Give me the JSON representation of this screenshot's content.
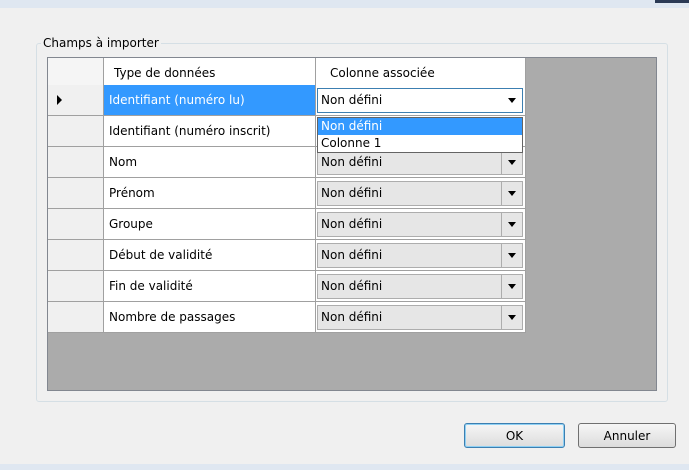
{
  "group_label": "Champs à importer",
  "columns": {
    "type": "Type de données",
    "column": "Colonne associée"
  },
  "rows": [
    {
      "type": "Identifiant (numéro lu)",
      "column": "Non défini"
    },
    {
      "type": "Identifiant (numéro inscrit)",
      "column": ""
    },
    {
      "type": "Nom",
      "column": "Non défini"
    },
    {
      "type": "Prénom",
      "column": "Non défini"
    },
    {
      "type": "Groupe",
      "column": "Non défini"
    },
    {
      "type": "Début de validité",
      "column": "Non défini"
    },
    {
      "type": "Fin de validité",
      "column": "Non défini"
    },
    {
      "type": "Nombre de passages",
      "column": "Non défini"
    }
  ],
  "dropdown_options": [
    "Non défini",
    "Colonne 1"
  ],
  "buttons": {
    "ok": "OK",
    "cancel": "Annuler"
  },
  "colors": {
    "selection": "#3399ff",
    "grid_background": "#ababab"
  }
}
